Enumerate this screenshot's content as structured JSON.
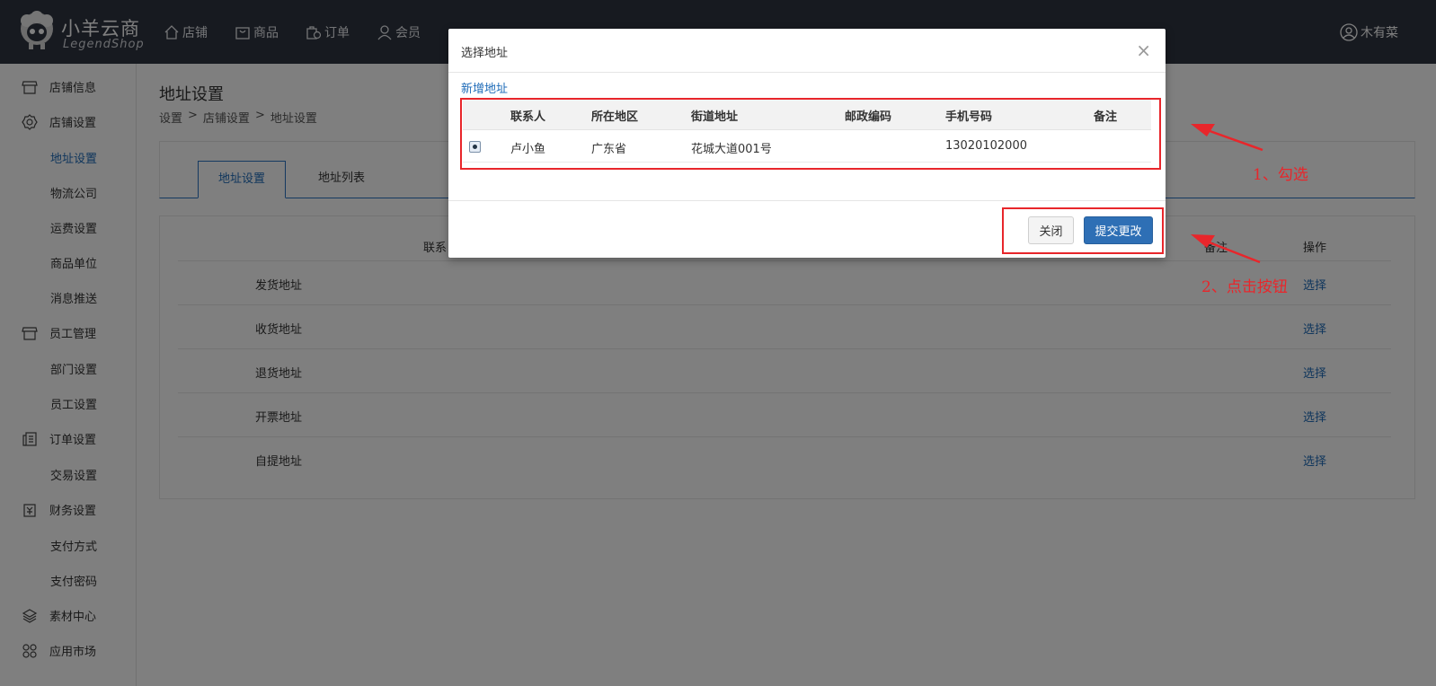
{
  "header": {
    "logo_cn": "小羊云商",
    "logo_en": "LegendShop",
    "nav": [
      {
        "label": "店铺",
        "icon": "home-icon"
      },
      {
        "label": "商品",
        "icon": "bag-icon"
      },
      {
        "label": "订单",
        "icon": "order-icon"
      },
      {
        "label": "会员",
        "icon": "user-icon"
      }
    ],
    "user_name": "木有菜"
  },
  "sidebar": {
    "groups": [
      {
        "label": "店铺信息",
        "icon": "store-icon"
      },
      {
        "label": "店铺设置",
        "icon": "gear-icon"
      },
      {
        "label": "员工管理",
        "icon": "store-icon"
      },
      {
        "label": "订单设置",
        "icon": "document-icon"
      },
      {
        "label": "财务设置",
        "icon": "finance-icon"
      },
      {
        "label": "素材中心",
        "icon": "layers-icon"
      },
      {
        "label": "应用市场",
        "icon": "apps-icon"
      }
    ],
    "subs": [
      "地址设置",
      "物流公司",
      "运费设置",
      "商品单位",
      "消息推送",
      "部门设置",
      "员工设置",
      "交易设置",
      "支付方式",
      "支付密码"
    ],
    "active": "地址设置"
  },
  "main": {
    "title": "地址设置",
    "breadcrumb": [
      "设置",
      ">",
      "店铺设置",
      ">",
      "地址设置"
    ],
    "tabs": [
      "地址设置",
      "地址列表"
    ],
    "table": {
      "headers": [
        "联系",
        "备注",
        "操作"
      ],
      "rows": [
        "发货地址",
        "收货地址",
        "退货地址",
        "开票地址",
        "自提地址"
      ],
      "action": "选择"
    }
  },
  "modal": {
    "title": "选择地址",
    "close_symbol": "×",
    "add_link": "新增地址",
    "headers": [
      "联系人",
      "所在地区",
      "街道地址",
      "邮政编码",
      "手机号码",
      "备注"
    ],
    "rows": [
      {
        "selected": true,
        "contact": "卢小鱼",
        "region": "广东省",
        "street": "花城大道001号",
        "postcode": "",
        "phone": "13020102000",
        "note": ""
      }
    ],
    "btn_close": "关闭",
    "btn_submit": "提交更改"
  },
  "annotations": {
    "step1": "1、勾选",
    "step2": "2、点击按钮",
    "color": "#e8262b"
  }
}
